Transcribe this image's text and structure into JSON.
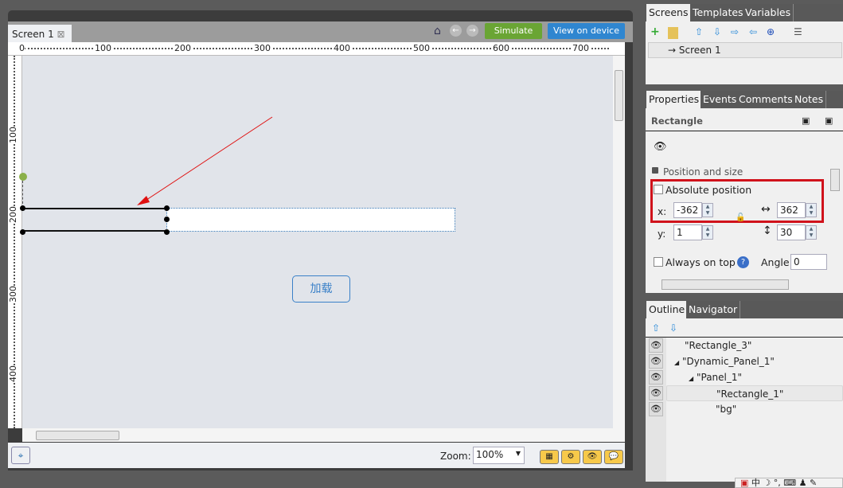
{
  "editor": {
    "tab_label": "Screen 1",
    "simulate_label": "Simulate",
    "view_on_device_label": "View on device",
    "ruler_h": [
      "0",
      "100",
      "200",
      "300",
      "400",
      "500",
      "600",
      "700"
    ],
    "ruler_v": [
      "100",
      "200",
      "300",
      "400"
    ],
    "canvas_button_label": "加载",
    "zoom_label": "Zoom:",
    "zoom_value": "100%",
    "colors": {
      "simulate": "#6aa534",
      "view_on_device": "#2f86d0",
      "canvas": "#e1e4ea",
      "arrow": "#e01010"
    }
  },
  "screens_panel": {
    "tabs": [
      "Screens",
      "Templates",
      "Variables"
    ],
    "items": [
      {
        "label": "Screen 1"
      }
    ]
  },
  "properties_panel": {
    "tabs": [
      "Properties",
      "Events",
      "Comments",
      "Notes"
    ],
    "element_type": "Rectangle",
    "section_title": "Position and size",
    "absolute_position_label": "Absolute position",
    "absolute_position_checked": false,
    "x_label": "x:",
    "x_value": "-362",
    "y_label": "y:",
    "y_value": "1",
    "width_value": "362",
    "height_value": "30",
    "always_on_top_label": "Always on top",
    "always_on_top_checked": false,
    "angle_label": "Angle",
    "angle_value": "0",
    "highlight_color": "#d0121b"
  },
  "outline_panel": {
    "tabs": [
      "Outline",
      "Navigator"
    ],
    "items": [
      {
        "label": "\"Rectangle_3\""
      },
      {
        "label": "\"Dynamic_Panel_1\""
      },
      {
        "label": "\"Panel_1\""
      },
      {
        "label": "\"Rectangle_1\""
      },
      {
        "label": "\"bg\""
      }
    ]
  },
  "taskbar": {
    "ime_label": "中"
  }
}
